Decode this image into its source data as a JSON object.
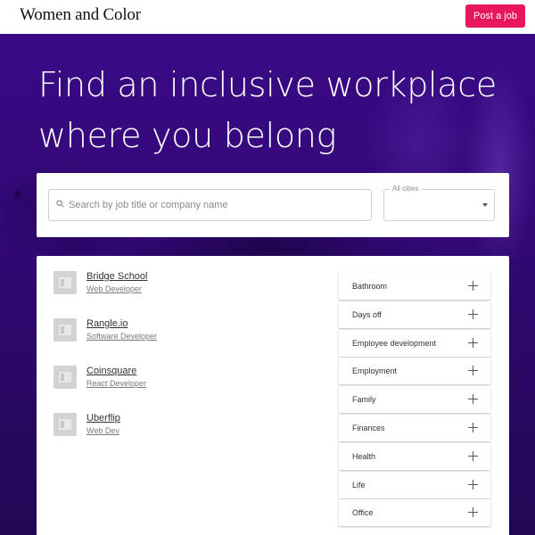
{
  "header": {
    "logo_text": "Women and Color",
    "post_job_label": "Post a job"
  },
  "hero": {
    "headline_line1": "Find an inclusive workplace",
    "headline_line2": "where you belong"
  },
  "search": {
    "placeholder": "Search by job title or company name",
    "city_label": "All cities",
    "city_value": ""
  },
  "companies": [
    {
      "name": "Bridge School",
      "role": "Web Developer"
    },
    {
      "name": "Rangle.io",
      "role": "Software Developer"
    },
    {
      "name": "Coinsquare",
      "role": "React Developer"
    },
    {
      "name": "Uberflip",
      "role": "Web Dev"
    }
  ],
  "filters": [
    {
      "label": "Bathroom"
    },
    {
      "label": "Days off"
    },
    {
      "label": "Employee development"
    },
    {
      "label": "Employment"
    },
    {
      "label": "Family"
    },
    {
      "label": "Finances"
    },
    {
      "label": "Health"
    },
    {
      "label": "Life"
    },
    {
      "label": "Office"
    }
  ],
  "colors": {
    "accent": "#e8175d",
    "hero": "#3a0a86"
  },
  "icons": {
    "search": "search-icon",
    "caret": "chevron-down-icon",
    "expand": "plus-icon",
    "company_logo": "image-placeholder-icon"
  }
}
